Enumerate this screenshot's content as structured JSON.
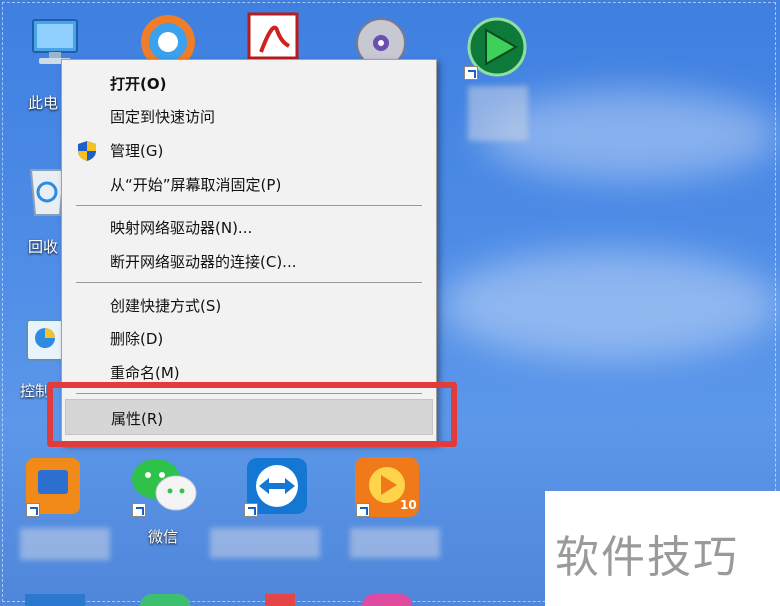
{
  "desktop": {
    "icons": {
      "this_pc_label": "此电",
      "recycle_label": "回收",
      "control_label": "控制",
      "wechat_label": "微信",
      "sunny_badge": "10"
    }
  },
  "context_menu": {
    "items": [
      {
        "label": "打开(O)"
      },
      {
        "label": "固定到快速访问"
      },
      {
        "label": "管理(G)"
      },
      {
        "label": "从“开始”屏幕取消固定(P)"
      },
      {
        "label": "映射网络驱动器(N)..."
      },
      {
        "label": "断开网络驱动器的连接(C)..."
      },
      {
        "label": "创建快捷方式(S)"
      },
      {
        "label": "删除(D)"
      },
      {
        "label": "重命名(M)"
      },
      {
        "label": "属性(R)"
      }
    ]
  },
  "watermark": {
    "text": "软件技巧"
  },
  "colors": {
    "highlight_box": "#e23b3b",
    "desktop_blue": "#4b8ae6",
    "menu_bg": "#f2f2f2"
  }
}
